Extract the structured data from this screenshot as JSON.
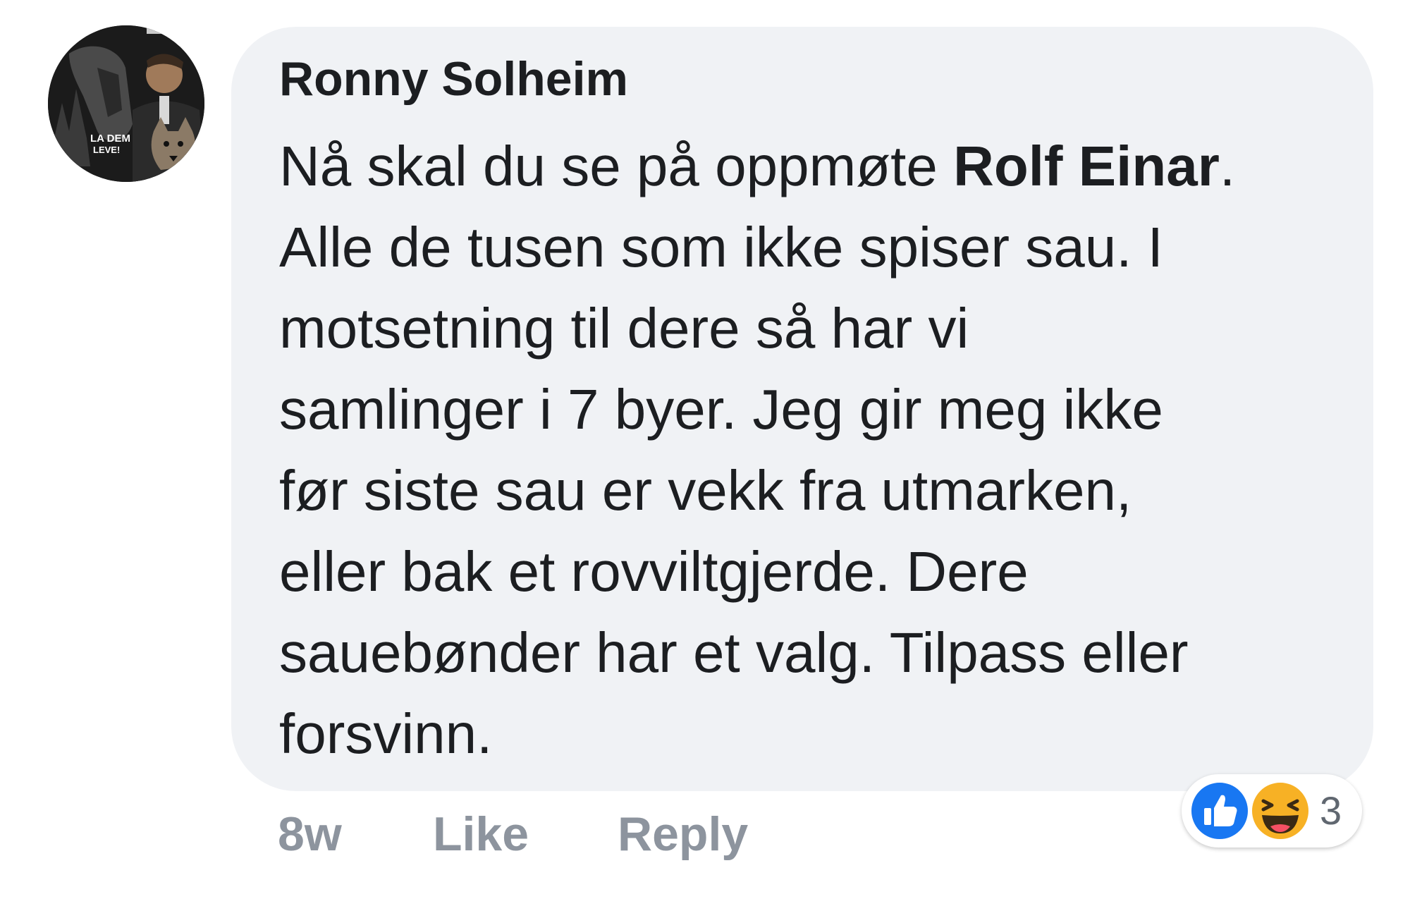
{
  "comment": {
    "author": "Ronny Solheim",
    "avatar_text": "LA DEM LEVE!",
    "text_lines": [
      {
        "before": "Nå skal du se på oppmøte ",
        "mention": "Rolf Einar",
        "after": "."
      },
      {
        "before": "Alle de tusen som ikke spiser sau. I"
      },
      {
        "before": "motsetning til dere så har vi"
      },
      {
        "before": "samlinger i 7 byer. Jeg gir meg ikke"
      },
      {
        "before": "før siste sau er vekk fra utmarken,"
      },
      {
        "before": "eller bak et rovviltgjerde. Dere"
      },
      {
        "before": "sauebønder har et valg. Tilpass eller"
      },
      {
        "before": "forsvinn."
      }
    ]
  },
  "actions": {
    "time": "8w",
    "like_label": "Like",
    "reply_label": "Reply"
  },
  "reactions": {
    "icons": [
      "like-icon",
      "haha-icon"
    ],
    "count": "3"
  },
  "colors": {
    "bubble": "#f0f2f5",
    "text": "#1c1e21",
    "muted": "#8d949e",
    "like_blue": "#1877f2",
    "haha_yellow": "#f7b125"
  }
}
